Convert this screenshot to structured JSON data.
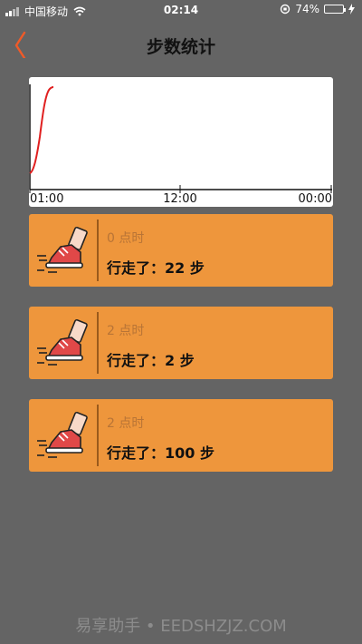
{
  "status_bar": {
    "carrier": "中国移动",
    "time": "02:14",
    "battery_percent": "74%",
    "battery_level": 0.74
  },
  "header": {
    "title": "步数统计",
    "back_icon": "chevron-left-icon"
  },
  "chart_data": {
    "type": "line",
    "x_tick_labels": [
      "01:00",
      "12:00",
      "00:00"
    ],
    "line_color": "#E02020"
  },
  "records": [
    {
      "hour_label": "0 点时",
      "walk_label": "行走了：22 步"
    },
    {
      "hour_label": "2 点时",
      "walk_label": "行走了：2 步"
    },
    {
      "hour_label": "2 点时",
      "walk_label": "行走了：100 步"
    }
  ],
  "watermark": "易享助手 • EEDSHZJZ.COM",
  "colors": {
    "background": "#646464",
    "card": "#EE963C",
    "accent": "#F05A28"
  }
}
